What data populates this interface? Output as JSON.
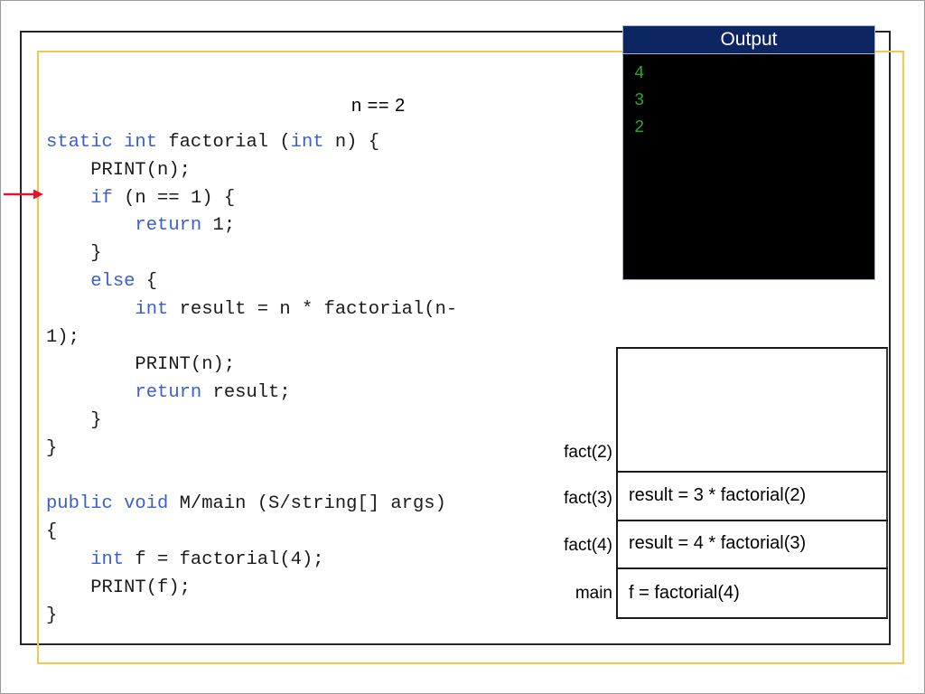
{
  "slide": {
    "annotation": "n == 2"
  },
  "code": {
    "lines": [
      [
        {
          "t": "static int",
          "k": true
        },
        {
          "t": " factorial (",
          "k": false
        },
        {
          "t": "int",
          "k": true
        },
        {
          "t": " n) {",
          "k": false
        }
      ],
      [
        {
          "t": "    PRINT(n);",
          "k": false
        }
      ],
      [
        {
          "t": "    ",
          "k": false
        },
        {
          "t": "if",
          "k": true
        },
        {
          "t": " (n == 1) {",
          "k": false
        }
      ],
      [
        {
          "t": "        ",
          "k": false
        },
        {
          "t": "return",
          "k": true
        },
        {
          "t": " 1;",
          "k": false
        }
      ],
      [
        {
          "t": "    }",
          "k": false
        }
      ],
      [
        {
          "t": "    ",
          "k": false
        },
        {
          "t": "else",
          "k": true
        },
        {
          "t": " {",
          "k": false
        }
      ],
      [
        {
          "t": "        ",
          "k": false
        },
        {
          "t": "int",
          "k": true
        },
        {
          "t": " result = n * factorial(n-",
          "k": false
        }
      ],
      [
        {
          "t": "1);",
          "k": false
        }
      ],
      [
        {
          "t": "        PRINT(n);",
          "k": false
        }
      ],
      [
        {
          "t": "        ",
          "k": false
        },
        {
          "t": "return",
          "k": true
        },
        {
          "t": " result;",
          "k": false
        }
      ],
      [
        {
          "t": "    }",
          "k": false
        }
      ],
      [
        {
          "t": "}",
          "k": false
        }
      ],
      [
        {
          "t": "",
          "k": false
        }
      ],
      [
        {
          "t": "public void",
          "k": true
        },
        {
          "t": " M/main (S/string[] args)",
          "k": false
        }
      ],
      [
        {
          "t": "{",
          "k": false
        }
      ],
      [
        {
          "t": "    ",
          "k": false
        },
        {
          "t": "int",
          "k": true
        },
        {
          "t": " f = factorial(4);",
          "k": false
        }
      ],
      [
        {
          "t": "    PRINT(f);",
          "k": false
        }
      ],
      [
        {
          "t": "}",
          "k": false
        }
      ]
    ]
  },
  "output": {
    "title": "Output",
    "lines": [
      "4",
      "3",
      "2"
    ],
    "text_color": "#22aa22",
    "header_color": "#0d2560",
    "body_color": "#000000"
  },
  "call_stack": {
    "frames": [
      {
        "label": "fact(2)",
        "body": ""
      },
      {
        "label": "fact(3)",
        "body": "result = 3 * factorial(2)"
      },
      {
        "label": "fact(4)",
        "body": "result = 4 * factorial(3)"
      },
      {
        "label": "main",
        "body": "f = factorial(4)"
      }
    ]
  },
  "colors": {
    "keyword_blue": "#3a5fcd",
    "frame_gold": "#f2c94c",
    "frame_dark": "#262626",
    "arrow_red": "#e8112d"
  }
}
